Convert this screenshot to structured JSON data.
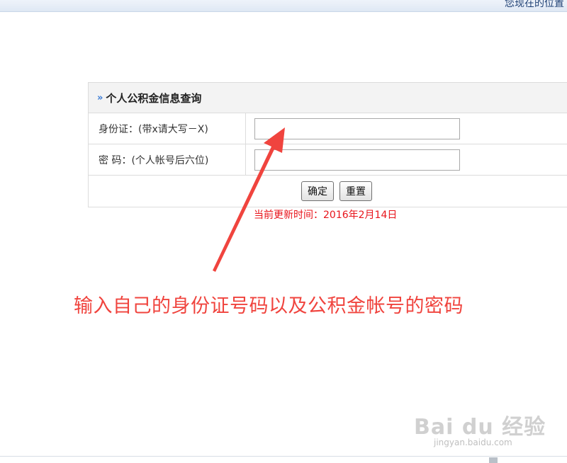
{
  "top_bar": {
    "text": "您现在的位置"
  },
  "form": {
    "title": "个人公积金信息查询",
    "id_label": "身份证：(带x请大写－X)",
    "id_value": "",
    "password_label": "密 码：(个人帐号后六位)",
    "password_value": "",
    "confirm_button": "确定",
    "reset_button": "重置",
    "update_time": "当前更新时间：2016年2月14日"
  },
  "annotation": {
    "text": "输入自己的身份证号码以及公积金帐号的密码",
    "color": "#f0443e"
  },
  "watermark": {
    "logo": "Bai du 经验",
    "url": "jingyan.baidu.com"
  },
  "colors": {
    "accent_blue": "#3a7bd5",
    "alert_red": "#e8141b"
  }
}
